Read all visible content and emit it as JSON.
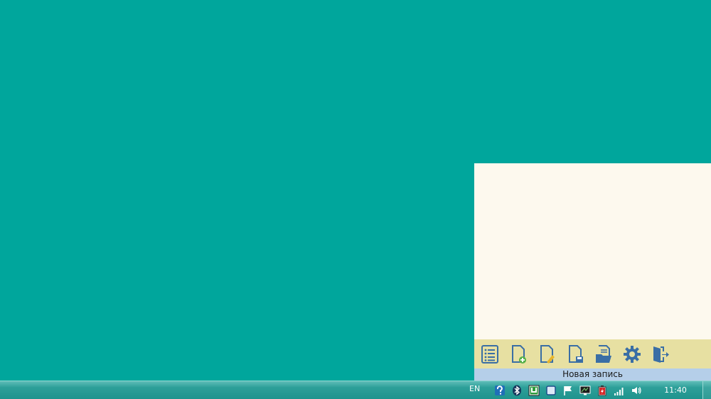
{
  "notes_app": {
    "note_text": "",
    "status": "Новая запись",
    "toolbar": [
      {
        "icon": "list-icon"
      },
      {
        "icon": "new-note-icon"
      },
      {
        "icon": "edit-note-icon"
      },
      {
        "icon": "save-note-icon"
      },
      {
        "icon": "open-folder-icon"
      },
      {
        "icon": "settings-gear-icon"
      },
      {
        "icon": "exit-icon"
      }
    ]
  },
  "taskbar": {
    "language": "EN",
    "clock": "11:40",
    "tray_icons": [
      "network-help-icon",
      "bluetooth-icon",
      "utorrent-icon",
      "box-icon",
      "action-center-flag-icon",
      "display-icon",
      "battery-icon",
      "signal-icon",
      "volume-icon"
    ]
  },
  "colors": {
    "desktop": "#00a69c",
    "note_background": "#fdf9ee",
    "toolbar": "#e7e0a2",
    "status_bar": "#b5cfe9",
    "icon_blue": "#3a6ea5",
    "accent_green": "#55b047"
  }
}
